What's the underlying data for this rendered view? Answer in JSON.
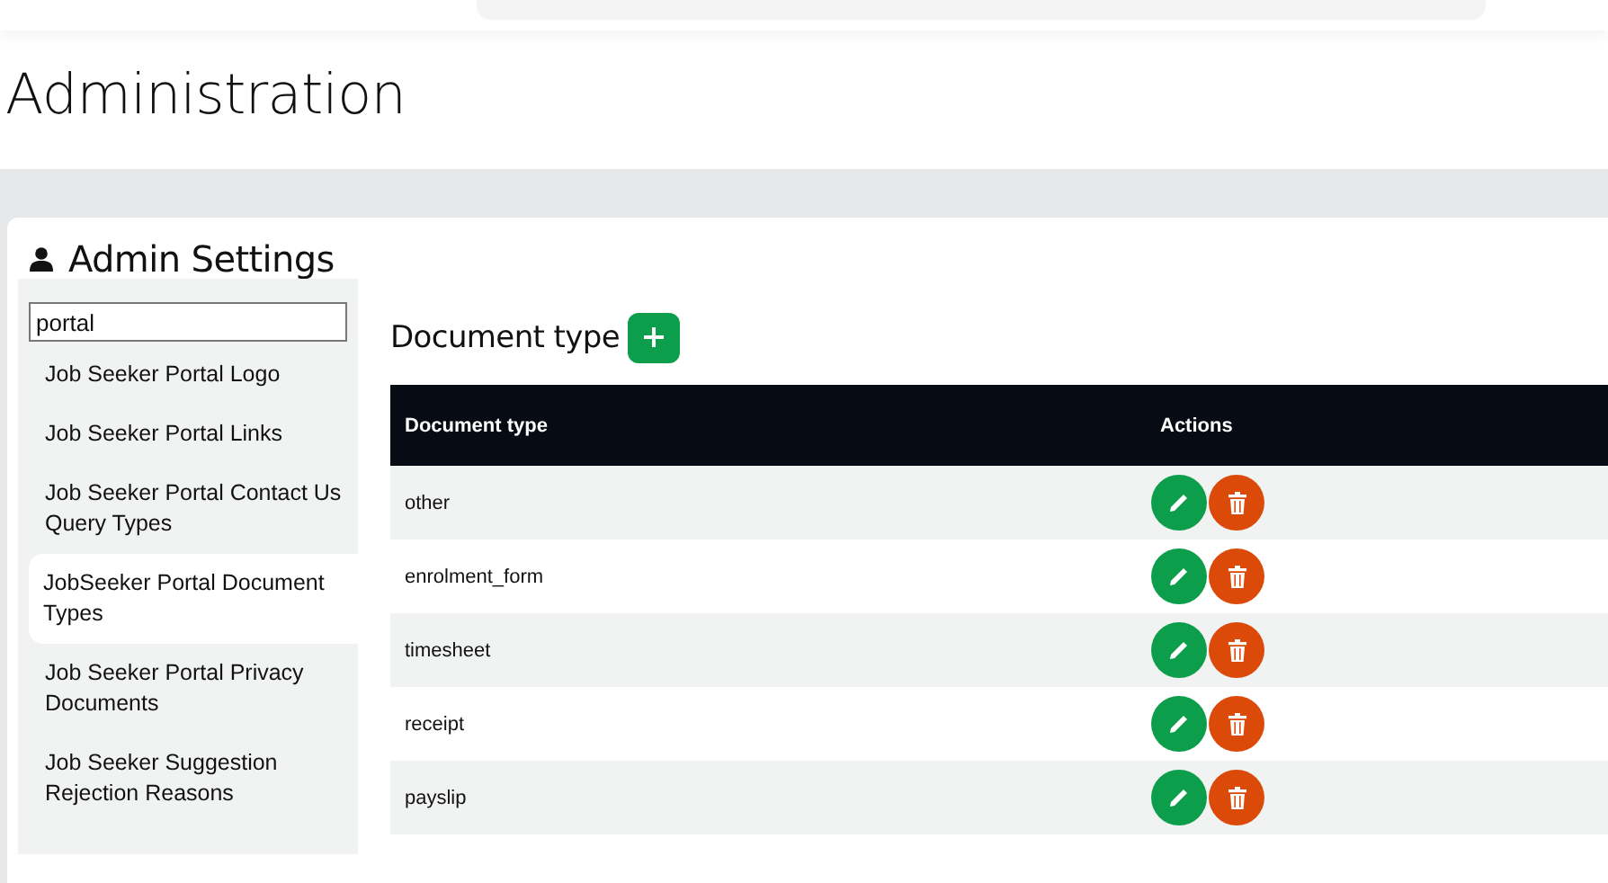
{
  "page_title": "Administration",
  "card_title": "Admin Settings",
  "sidebar": {
    "search_value": "portal",
    "items": [
      {
        "label": "Job Seeker Portal Logo",
        "selected": false
      },
      {
        "label": "Job Seeker Portal Links",
        "selected": false
      },
      {
        "label": "Job Seeker Portal Contact Us Query Types",
        "selected": false
      },
      {
        "label": "JobSeeker Portal Document Types",
        "selected": true
      },
      {
        "label": "Job Seeker Portal Privacy Documents",
        "selected": false
      },
      {
        "label": "Job Seeker Suggestion Rejection Reasons",
        "selected": false
      }
    ]
  },
  "section_title": "Document type",
  "table": {
    "columns": [
      "Document type",
      "Actions"
    ],
    "rows": [
      {
        "document_type": "other"
      },
      {
        "document_type": "enrolment_form"
      },
      {
        "document_type": "timesheet"
      },
      {
        "document_type": "receipt"
      },
      {
        "document_type": "payslip"
      }
    ]
  }
}
